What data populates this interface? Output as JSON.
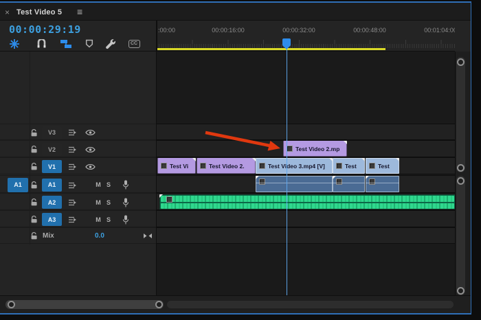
{
  "panel": {
    "name": "Timeline panel",
    "focus_border_color": "#2f6fb8"
  },
  "tab": {
    "close_icon": "×",
    "title": "Test Video 5",
    "menu_icon": "≡"
  },
  "playhead": {
    "timecode": "00:00:29:19",
    "head_color": "#2d8ceb"
  },
  "toolbar": {
    "icons": [
      {
        "name": "nested-sequence-icon",
        "active": true
      },
      {
        "name": "snap-icon",
        "active": false
      },
      {
        "name": "linked-selection-icon",
        "active": true
      },
      {
        "name": "add-marker-icon",
        "active": false
      },
      {
        "name": "timeline-settings-icon",
        "active": false
      },
      {
        "name": "captions-icon",
        "active": false
      }
    ],
    "cc_label": "CC"
  },
  "ruler": {
    "labels": [
      ":00:00",
      "00:00:16:00",
      "00:00:32:00",
      "00:00:48:00",
      "00:01:04:00"
    ],
    "work_area_color": "#d9d926"
  },
  "tracks": [
    {
      "name": "V3",
      "type": "video",
      "targeted": false
    },
    {
      "name": "V2",
      "type": "video",
      "targeted": false
    },
    {
      "name": "V1",
      "type": "video",
      "targeted": true
    },
    {
      "name": "A1",
      "type": "audio",
      "targeted": true,
      "source_patch": "A1",
      "mute": "M",
      "solo": "S"
    },
    {
      "name": "A2",
      "type": "audio",
      "targeted": true,
      "mute": "M",
      "solo": "S"
    },
    {
      "name": "A3",
      "type": "audio",
      "targeted": true,
      "mute": "M",
      "solo": "S"
    },
    {
      "name": "Mix",
      "type": "master",
      "value": "0.0"
    }
  ],
  "timeline": {
    "v2_clips": [
      {
        "label": "Test Video 2.mp",
        "color": "#b49ae2",
        "selected": false
      }
    ],
    "v1_clips": [
      {
        "label": "Test Vi",
        "color": "#b49ae2",
        "selected": false
      },
      {
        "label": "Test Video 2.",
        "color": "#b49ae2",
        "selected": false
      },
      {
        "label": "Test Video 3.mp4 [V]",
        "color": "#9db9dc",
        "selected": true
      },
      {
        "label": "Test",
        "color": "#9db9dc",
        "selected": true
      },
      {
        "label": "Test",
        "color": "#9db9dc",
        "selected": true
      }
    ],
    "a1_clips": [
      {
        "selected": true
      },
      {
        "selected": true
      },
      {
        "selected": true
      }
    ],
    "a2_clip": {
      "color": "#0d6848",
      "waveform_color": "#2fd88e"
    }
  },
  "annotation": {
    "type": "red-arrow",
    "color": "#e0380f"
  }
}
